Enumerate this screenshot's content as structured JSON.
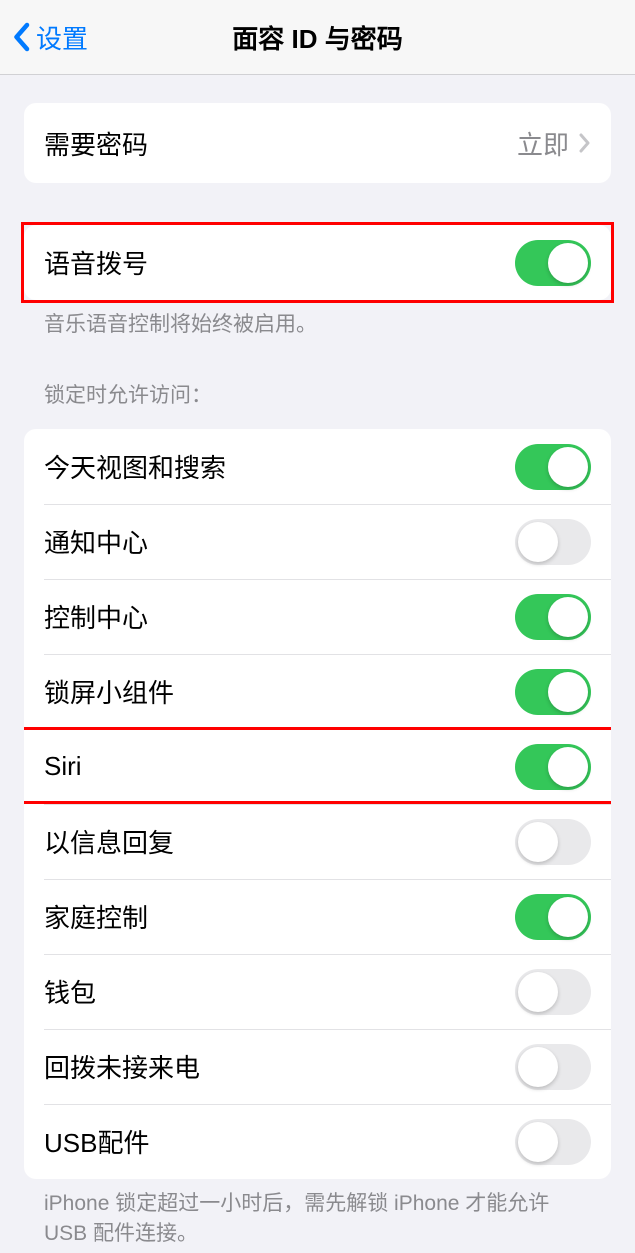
{
  "header": {
    "back_label": "设置",
    "title": "面容 ID 与密码"
  },
  "require_passcode": {
    "label": "需要密码",
    "value": "立即"
  },
  "voice_dial": {
    "label": "语音拨号",
    "on": true,
    "footer": "音乐语音控制将始终被启用。"
  },
  "lock_access": {
    "header": "锁定时允许访问：",
    "items": [
      {
        "label": "今天视图和搜索",
        "on": true,
        "name": "today-view-search"
      },
      {
        "label": "通知中心",
        "on": false,
        "name": "notification-center"
      },
      {
        "label": "控制中心",
        "on": true,
        "name": "control-center"
      },
      {
        "label": "锁屏小组件",
        "on": true,
        "name": "lock-screen-widgets"
      },
      {
        "label": "Siri",
        "on": true,
        "name": "siri"
      },
      {
        "label": "以信息回复",
        "on": false,
        "name": "reply-with-message"
      },
      {
        "label": "家庭控制",
        "on": true,
        "name": "home-control"
      },
      {
        "label": "钱包",
        "on": false,
        "name": "wallet"
      },
      {
        "label": "回拨未接来电",
        "on": false,
        "name": "return-missed-calls"
      },
      {
        "label": "USB配件",
        "on": false,
        "name": "usb-accessories"
      }
    ],
    "footer": "iPhone 锁定超过一小时后，需先解锁 iPhone 才能允许USB 配件连接。"
  },
  "highlights": {
    "voice_dial": true,
    "siri": true
  }
}
